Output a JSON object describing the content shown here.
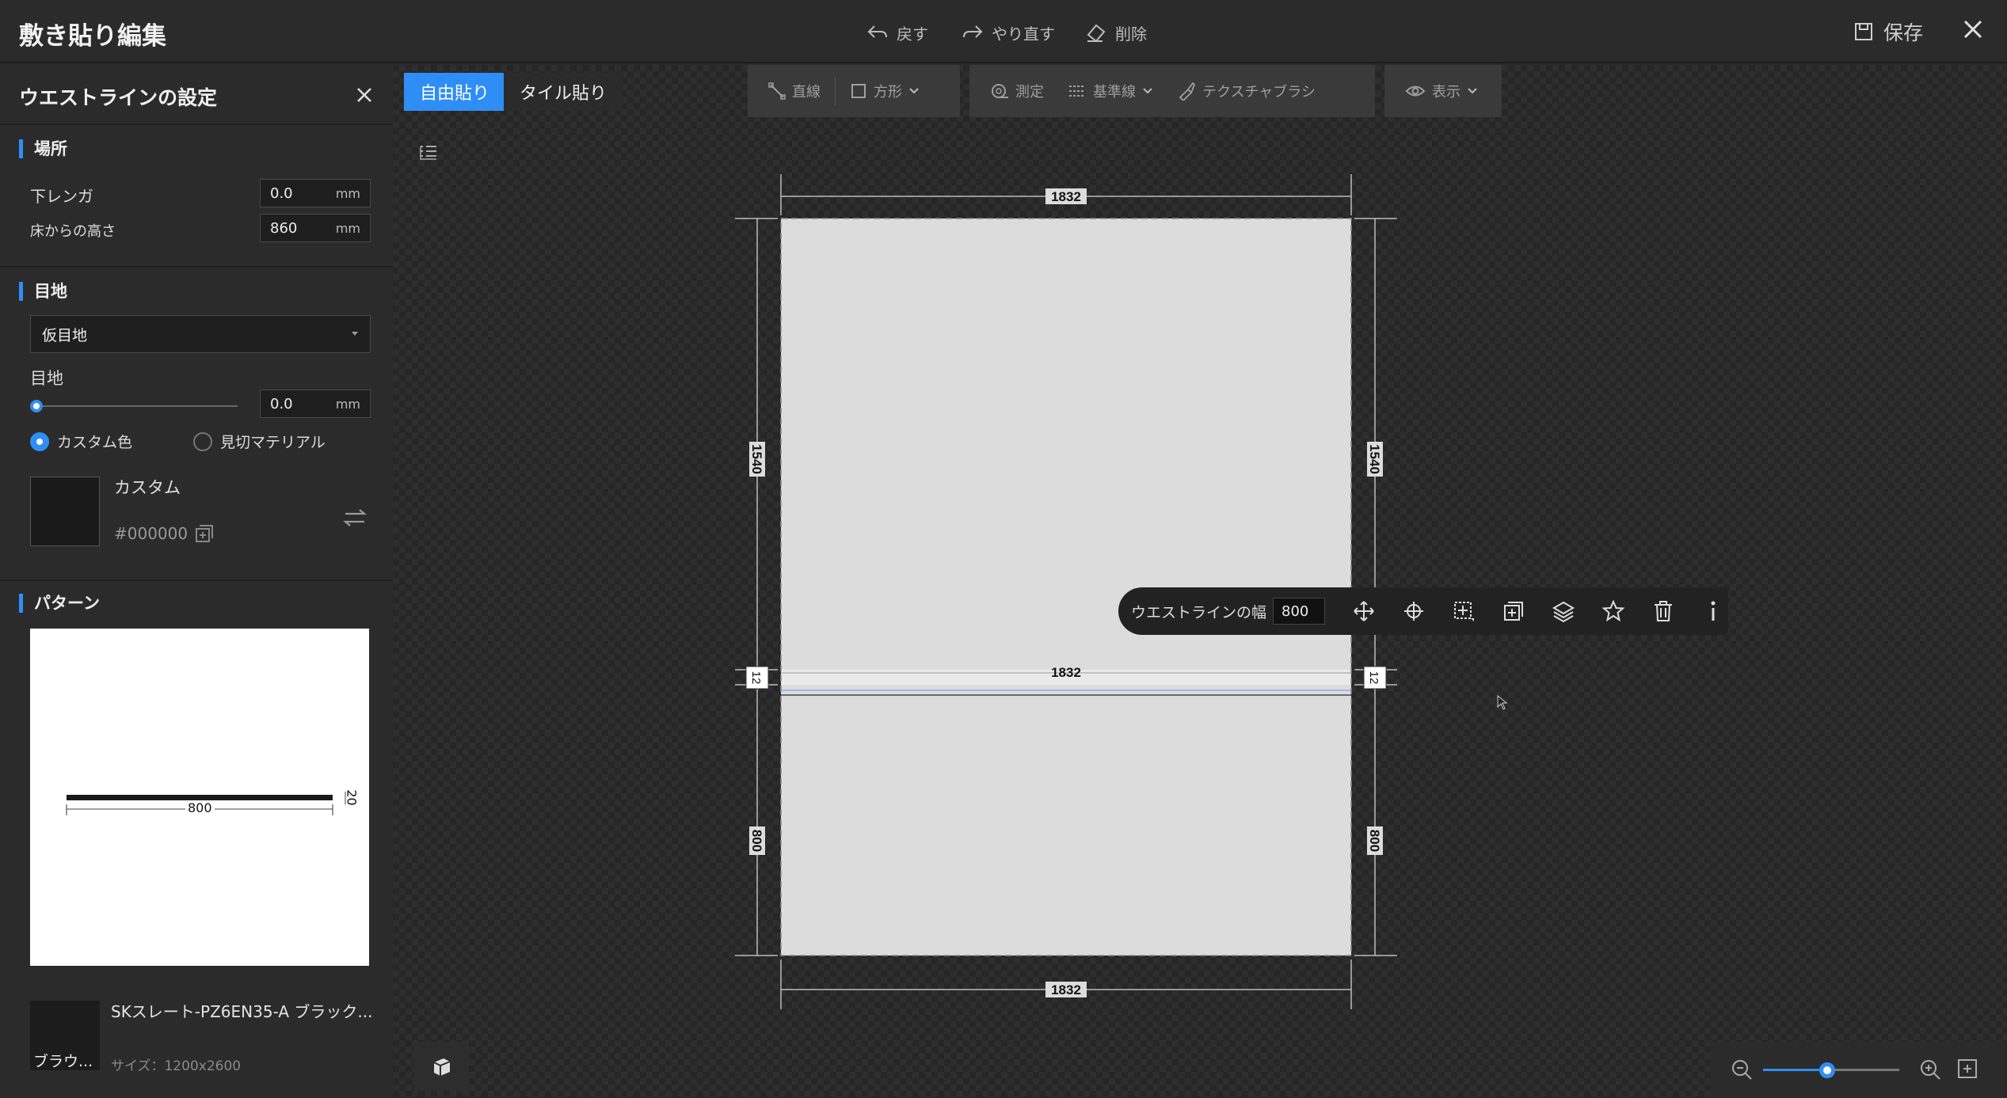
{
  "header": {
    "title": "敷き貼り編集",
    "undo_label": "戻す",
    "redo_label": "やり直す",
    "delete_label": "削除",
    "save_label": "保存"
  },
  "panel": {
    "title": "ウエストラインの設定",
    "location": {
      "heading": "場所",
      "base_label": "下レンガ",
      "base_value": "0.0",
      "height_label": "床からの高さ",
      "height_value": "860",
      "unit": "mm"
    },
    "joint": {
      "heading": "目地",
      "select_value": "仮目地",
      "width_label": "目地",
      "width_value": "0.0",
      "width_fraction": 0.0,
      "unit": "mm",
      "radio_custom": "カスタム色",
      "radio_material": "見切マテリアル",
      "selected_radio": "カスタム色",
      "color_name": "カスタム",
      "color_hex": "#000000"
    },
    "pattern": {
      "heading": "パターン",
      "length": "800",
      "thickness": "20"
    },
    "material": {
      "name": "SKスレート-PZ6EN35-A ブラック...",
      "thumb_label": "ブラウ...",
      "size": "サイズ：1200x2600"
    }
  },
  "canvas": {
    "tab_free": "自由貼り",
    "tab_tile": "タイル貼り",
    "toolbar": {
      "line": "直線",
      "rect": "方形",
      "measure": "測定",
      "baseline": "基準線",
      "texture_brush": "テクスチャブラシ",
      "display": "表示"
    },
    "dims": {
      "top_width": "1832",
      "mid_width": "1832",
      "bottom_width": "1832",
      "upper_height_left": "1540",
      "upper_height_right": "1540",
      "joint_left": "12",
      "joint_right": "12",
      "lower_height_left": "800",
      "lower_height_right": "800"
    },
    "float_toolbar": {
      "label": "ウエストラインの幅",
      "value": "800"
    },
    "zoom_fraction": 0.47
  },
  "colors": {
    "accent": "#2f8ef5",
    "background": "#2a2a2a",
    "wall": "#dcdcdc"
  }
}
